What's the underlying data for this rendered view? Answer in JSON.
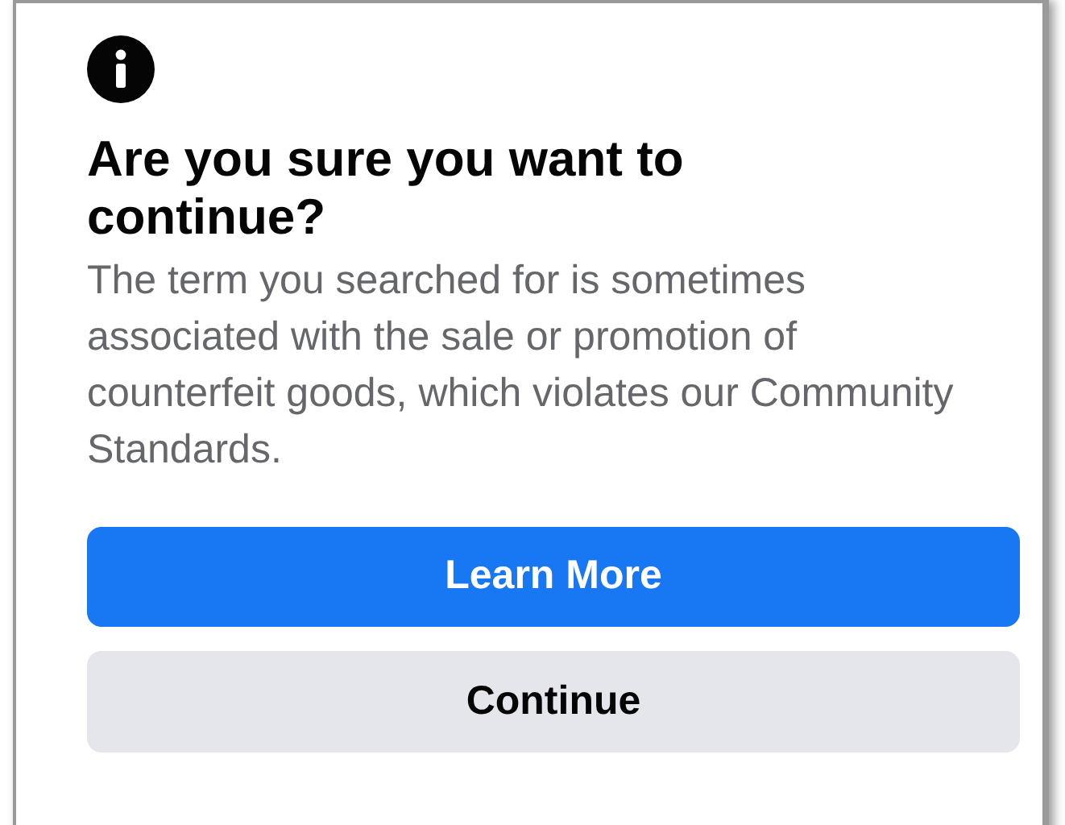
{
  "dialog": {
    "title": "Are you sure you want to continue?",
    "message": "The term you searched for is sometimes associated with the sale or promotion of counterfeit goods, which violates our Community Standards.",
    "buttons": [
      {
        "label": "Learn More",
        "kind": "primary"
      },
      {
        "label": "Continue",
        "kind": "secondary"
      }
    ]
  }
}
